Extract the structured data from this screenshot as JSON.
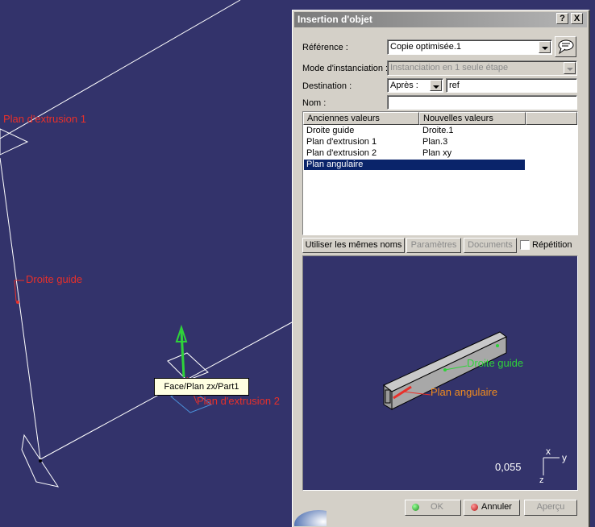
{
  "viewport": {
    "labels": {
      "plan_extrusion_1": "Plan d'extrusion 1",
      "droite_guide": "Droite guide",
      "plan_extrusion_2": "Plan d'extrusion 2"
    },
    "tooltip": "Face/Plan zx/Part1"
  },
  "dialog": {
    "title": "Insertion d'objet",
    "help_btn": "?",
    "close_btn": "X",
    "reference_label": "Référence :",
    "reference_value": "Copie optimisée.1",
    "mode_label": "Mode d'instanciation :",
    "mode_value": "Instanciation en 1 seule étape",
    "destination_label": "Destination :",
    "destination_mode": "Après :",
    "destination_value": "ref",
    "nom_label": "Nom :",
    "nom_value": "",
    "columns": [
      "Anciennes valeurs",
      "Nouvelles valeurs"
    ],
    "rows": [
      {
        "old": "Droite guide",
        "new": "Droite.1"
      },
      {
        "old": "Plan d'extrusion 1",
        "new": "Plan.3"
      },
      {
        "old": "Plan d'extrusion 2",
        "new": "Plan xy"
      },
      {
        "old": "Plan angulaire",
        "new": ""
      }
    ],
    "selected_row": 3,
    "btn_same_names": "Utiliser les mêmes noms",
    "btn_parameters": "Paramètres",
    "btn_documents": "Documents",
    "repetition_label": "Répétition",
    "repetition_checked": false,
    "preview": {
      "label_droite": "Droite guide",
      "label_plan": "Plan angulaire",
      "scale": "0,055",
      "axis_x": "x",
      "axis_y": "y",
      "axis_z": "z"
    },
    "btn_ok": "OK",
    "btn_cancel": "Annuler",
    "btn_preview": "Aperçu"
  },
  "colors": {
    "background": "#33336b",
    "selection": "#0a246a",
    "label_red": "#e8302a",
    "label_green": "#2fd33a",
    "label_orange": "#f28c1e"
  }
}
